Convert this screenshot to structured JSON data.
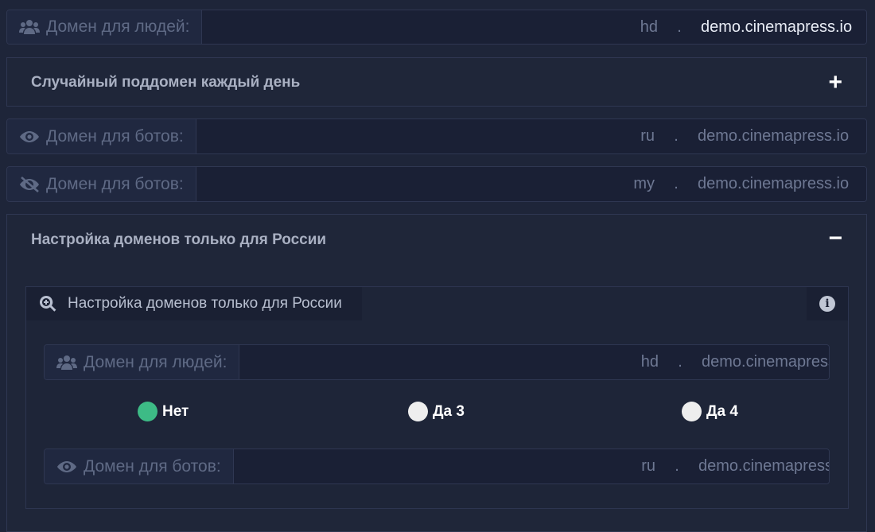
{
  "rows": {
    "people_main": {
      "label": "Домен для людей:",
      "subdomain": "hd",
      "dot": ".",
      "domain": "demo.cinemapress.io"
    },
    "bots_ru": {
      "label": "Домен для ботов:",
      "subdomain": "ru",
      "dot": ".",
      "domain": "demo.cinemapress.io"
    },
    "bots_my": {
      "label": "Домен для ботов:",
      "subdomain": "my",
      "dot": ".",
      "domain": "demo.cinemapress.io"
    }
  },
  "panels": {
    "random_subdomain": {
      "title": "Случайный поддомен каждый день",
      "toggle": "+"
    },
    "russia": {
      "title": "Настройка доменов только для России",
      "toggle": "−"
    }
  },
  "russia": {
    "tab_label": "Настройка доменов только для России",
    "info": "i",
    "people": {
      "label": "Домен для людей:",
      "subdomain": "hd",
      "dot": ".",
      "domain": "demo.cinemapress.io"
    },
    "bots": {
      "label": "Домен для ботов:",
      "subdomain": "ru",
      "dot": ".",
      "domain": "demo.cinemapress.io"
    },
    "options": [
      {
        "label": "Нет",
        "selected": true
      },
      {
        "label": "Да 3",
        "selected": false
      },
      {
        "label": "Да 4",
        "selected": false
      }
    ]
  },
  "icons": {
    "people": "users-icon",
    "eye": "eye-icon",
    "eye_slash": "eye-slash-icon",
    "search": "search-plus-icon",
    "info": "info-icon"
  },
  "colors": {
    "background": "#1e2539",
    "accent": "#3dbb86",
    "label": "#5f6a85"
  }
}
